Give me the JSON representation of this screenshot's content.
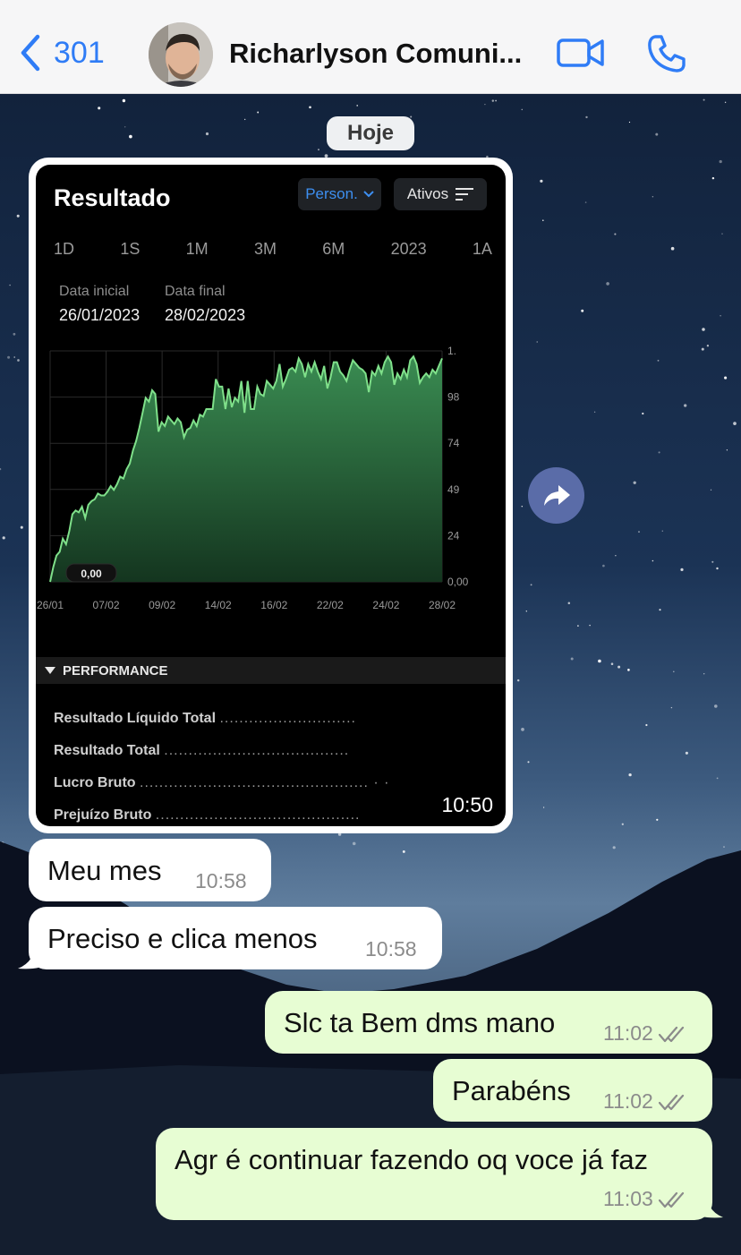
{
  "header": {
    "back_count": "301",
    "contact_name": "Richarlyson Comuni...",
    "icons": [
      "chevron-left-icon",
      "video-call-icon",
      "phone-icon"
    ]
  },
  "date_separator": "Hoje",
  "media_message": {
    "screen_title": "Resultado",
    "period_dropdown": "Person.",
    "assets_button": "Ativos",
    "periods": [
      "1D",
      "1S",
      "1M",
      "3M",
      "6M",
      "2023",
      "1A"
    ],
    "start_label": "Data inicial",
    "start_value": "26/01/2023",
    "end_label": "Data final",
    "end_value": "28/02/2023",
    "performance_header": "PERFORMANCE",
    "performance_rows": [
      {
        "label": "Resultado Líquido Total",
        "dots": "............................"
      },
      {
        "label": "Resultado Total",
        "dots": "......................................"
      },
      {
        "label": "Lucro Bruto",
        "dots": "...............................................  ·  ·"
      },
      {
        "label": "Prejuízo Bruto",
        "dots": ".........................................."
      }
    ],
    "time": "10:50"
  },
  "chart_data": {
    "type": "area",
    "x_tick_labels": [
      "26/01",
      "07/02",
      "09/02",
      "14/02",
      "16/02",
      "22/02",
      "24/02",
      "28/02"
    ],
    "y_tick_labels": [
      "0,00",
      "24",
      "49",
      "74",
      "98",
      "1."
    ],
    "ylim": [
      0,
      123
    ],
    "start_marker": "0,00",
    "line_color": "#7fe08a",
    "fill_color": "#2f7a45",
    "values": [
      0,
      8,
      14,
      16,
      23,
      20,
      27,
      36,
      38,
      37,
      40,
      34,
      41,
      43,
      44,
      47,
      46,
      46,
      48,
      51,
      49,
      52,
      56,
      55,
      60,
      63,
      70,
      75,
      82,
      90,
      98,
      96,
      102,
      100,
      80,
      85,
      83,
      88,
      86,
      84,
      87,
      85,
      77,
      81,
      82,
      86,
      83,
      89,
      88,
      92,
      92,
      92,
      108,
      104,
      104,
      92,
      103,
      93,
      98,
      96,
      107,
      90,
      107,
      92,
      92,
      104,
      100,
      99,
      107,
      105,
      103,
      107,
      116,
      104,
      108,
      113,
      114,
      112,
      119,
      116,
      109,
      116,
      112,
      117,
      112,
      108,
      115,
      103,
      109,
      117,
      117,
      112,
      110,
      107,
      113,
      118,
      116,
      114,
      113,
      111,
      101,
      112,
      110,
      115,
      111,
      117,
      120,
      117,
      105,
      111,
      108,
      113,
      109,
      118,
      120,
      116,
      106,
      109,
      111,
      109,
      113,
      111,
      115,
      119
    ]
  },
  "messages": [
    {
      "dir": "in",
      "text": "Meu mes",
      "time": "10:58"
    },
    {
      "dir": "in",
      "text": "Preciso e clica menos",
      "time": "10:58"
    },
    {
      "dir": "out",
      "text": "Slc ta Bem dms mano",
      "time": "11:02"
    },
    {
      "dir": "out",
      "text": "Parabéns",
      "time": "11:02"
    },
    {
      "dir": "out",
      "text": "Agr é continuar fazendo oq voce já faz",
      "time": "11:03"
    }
  ],
  "colors": {
    "accent": "#2f7cf6",
    "outgoing_bubble": "#e7fdd3",
    "incoming_bubble": "#ffffff",
    "forward_button": "#5a6ca8"
  }
}
